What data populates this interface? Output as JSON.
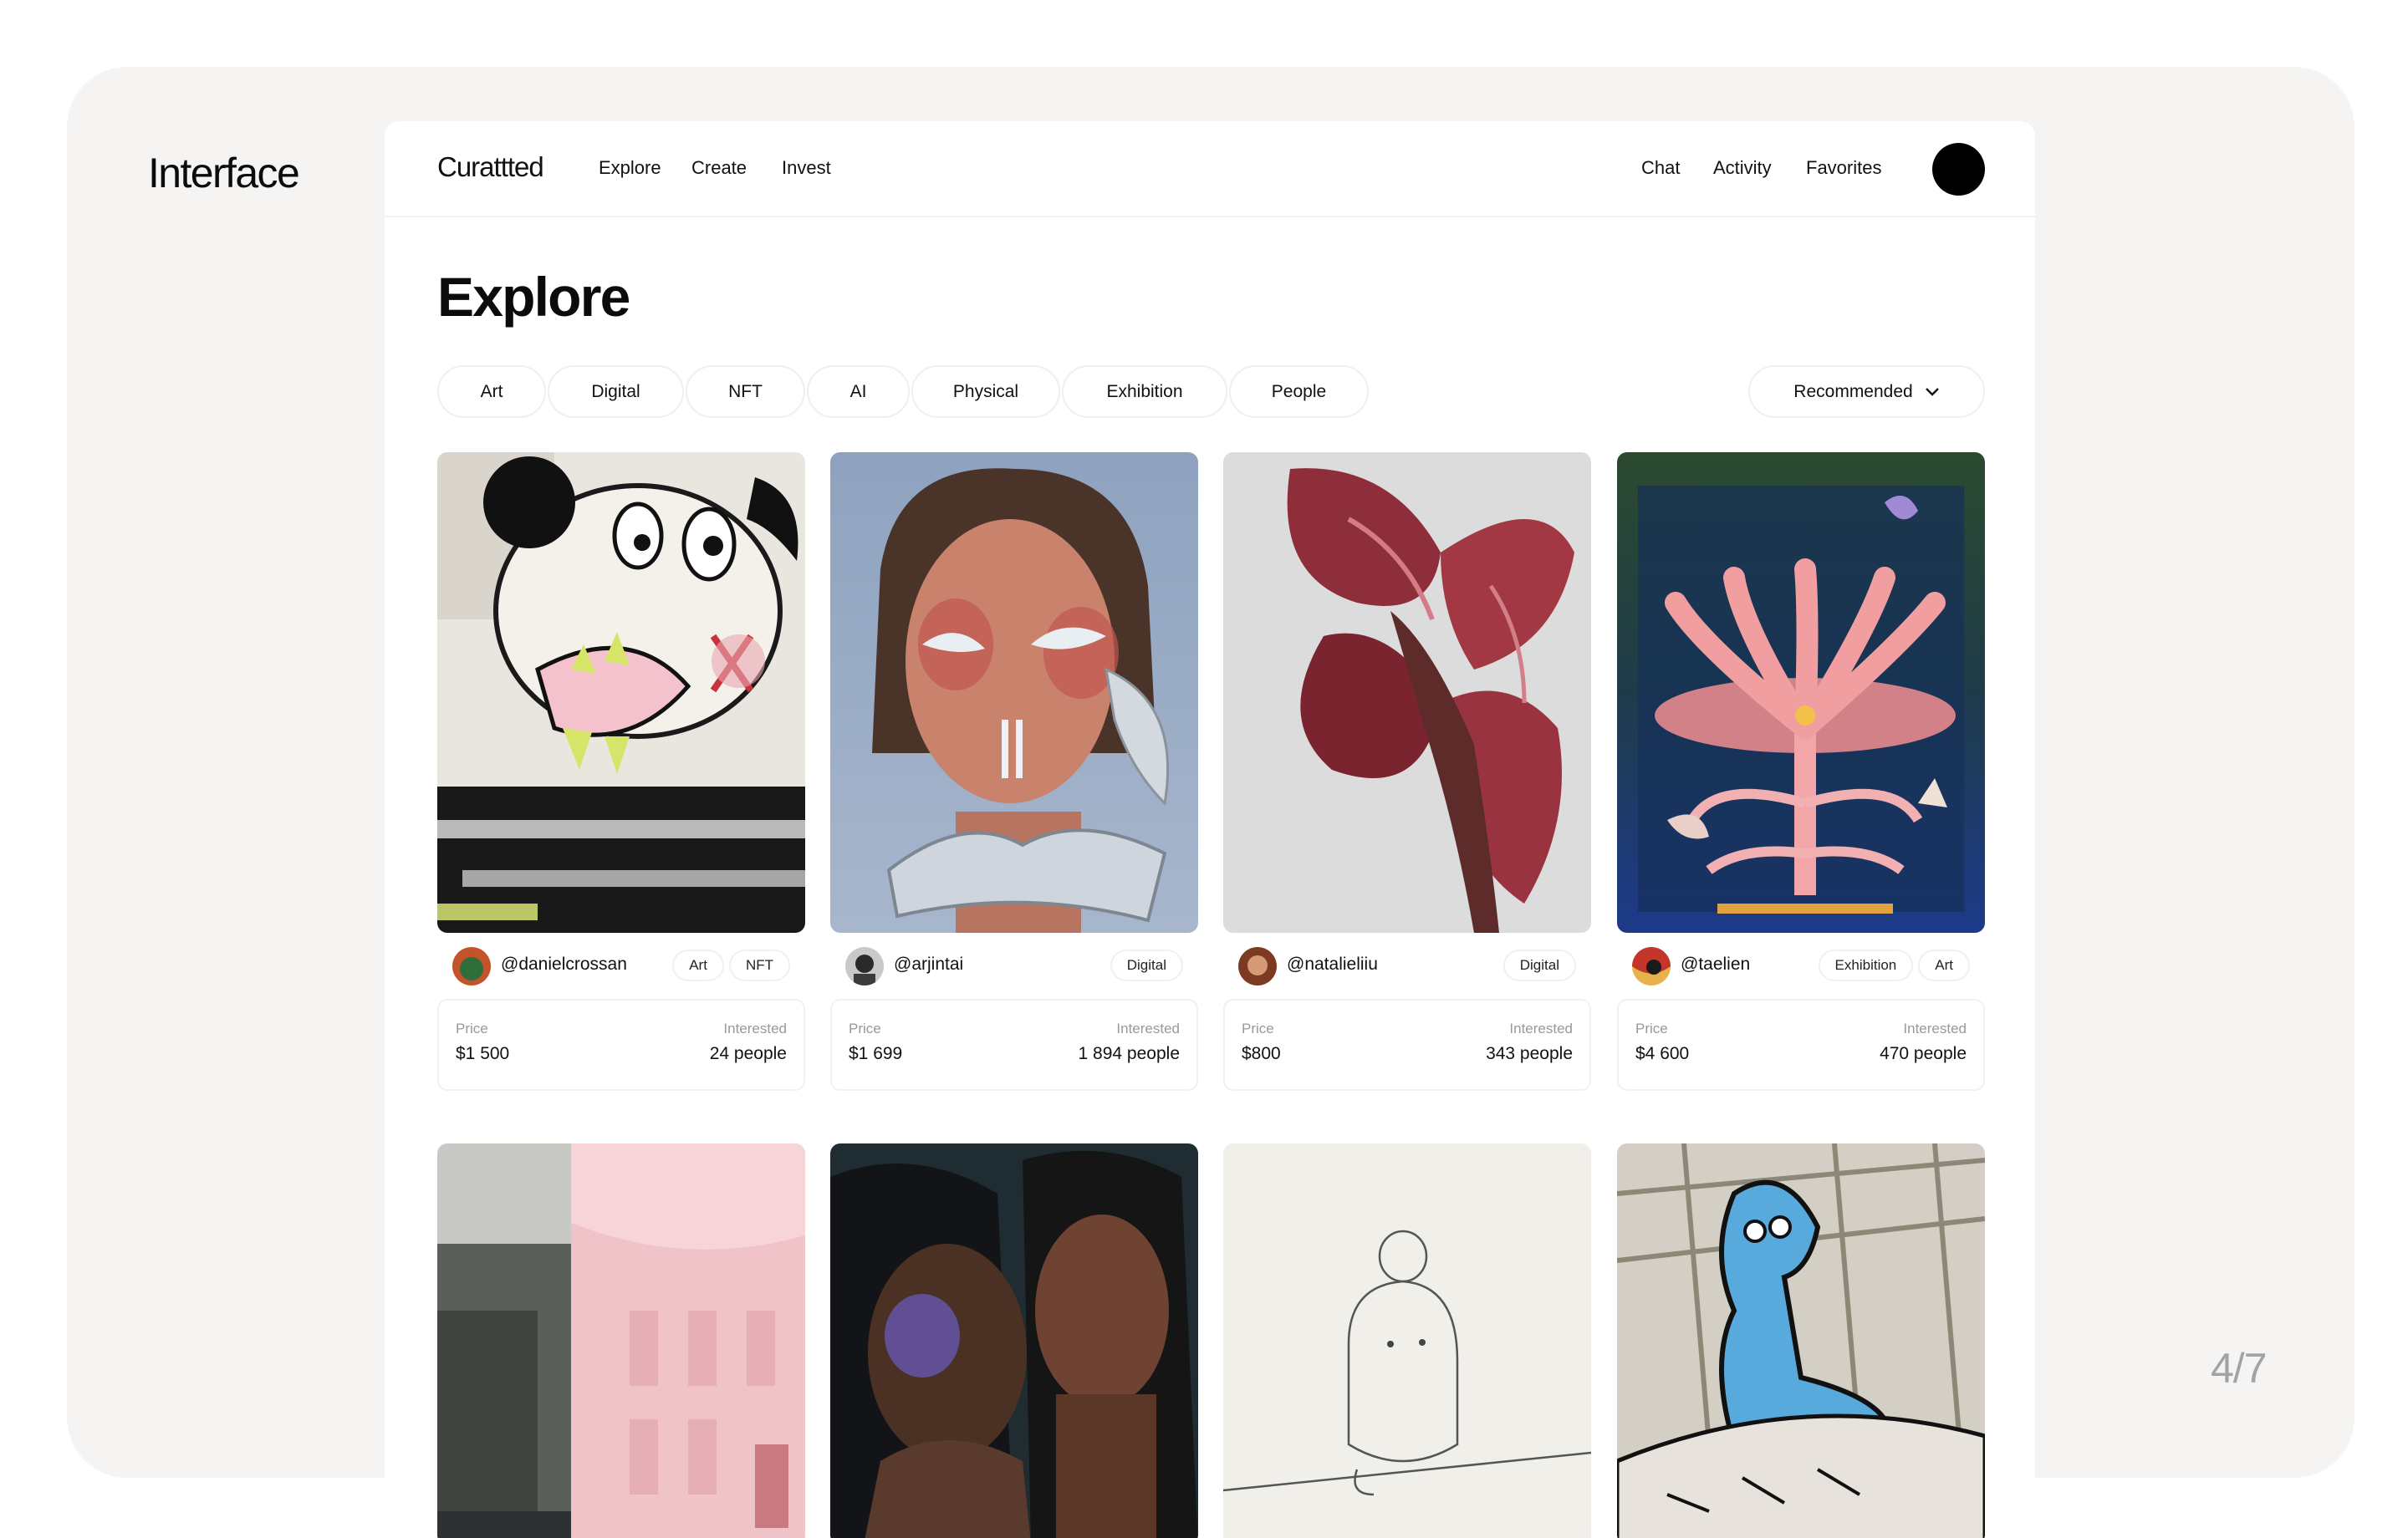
{
  "slide": {
    "brand": "Interface",
    "counter": "4/7"
  },
  "topbar": {
    "logo": "Curattted",
    "nav_left": [
      "Explore",
      "Create",
      "Invest"
    ],
    "nav_right": [
      "Chat",
      "Activity",
      "Favorites"
    ]
  },
  "page": {
    "title": "Explore"
  },
  "filters": [
    "Art",
    "Digital",
    "NFT",
    "AI",
    "Physical",
    "Exhibition",
    "People"
  ],
  "sort": {
    "label": "Recommended",
    "icon": "chevron-down-icon"
  },
  "price_label": "Price",
  "interested_label": "Interested",
  "cards": [
    {
      "handle": "@danielcrossan",
      "tags": [
        "Art",
        "NFT"
      ],
      "price": "$1 500",
      "interested": "24 people"
    },
    {
      "handle": "@arjintai",
      "tags": [
        "Digital"
      ],
      "price": "$1 699",
      "interested": "1 894 people"
    },
    {
      "handle": "@natalieliiu",
      "tags": [
        "Digital"
      ],
      "price": "$800",
      "interested": "343 people"
    },
    {
      "handle": "@taelien",
      "tags": [
        "Exhibition",
        "Art"
      ],
      "price": "$4 600",
      "interested": "470 people"
    }
  ],
  "colors": {
    "backdrop": "#f5f4f3",
    "avatar": "#000000",
    "counter": "#a3a3a3"
  }
}
